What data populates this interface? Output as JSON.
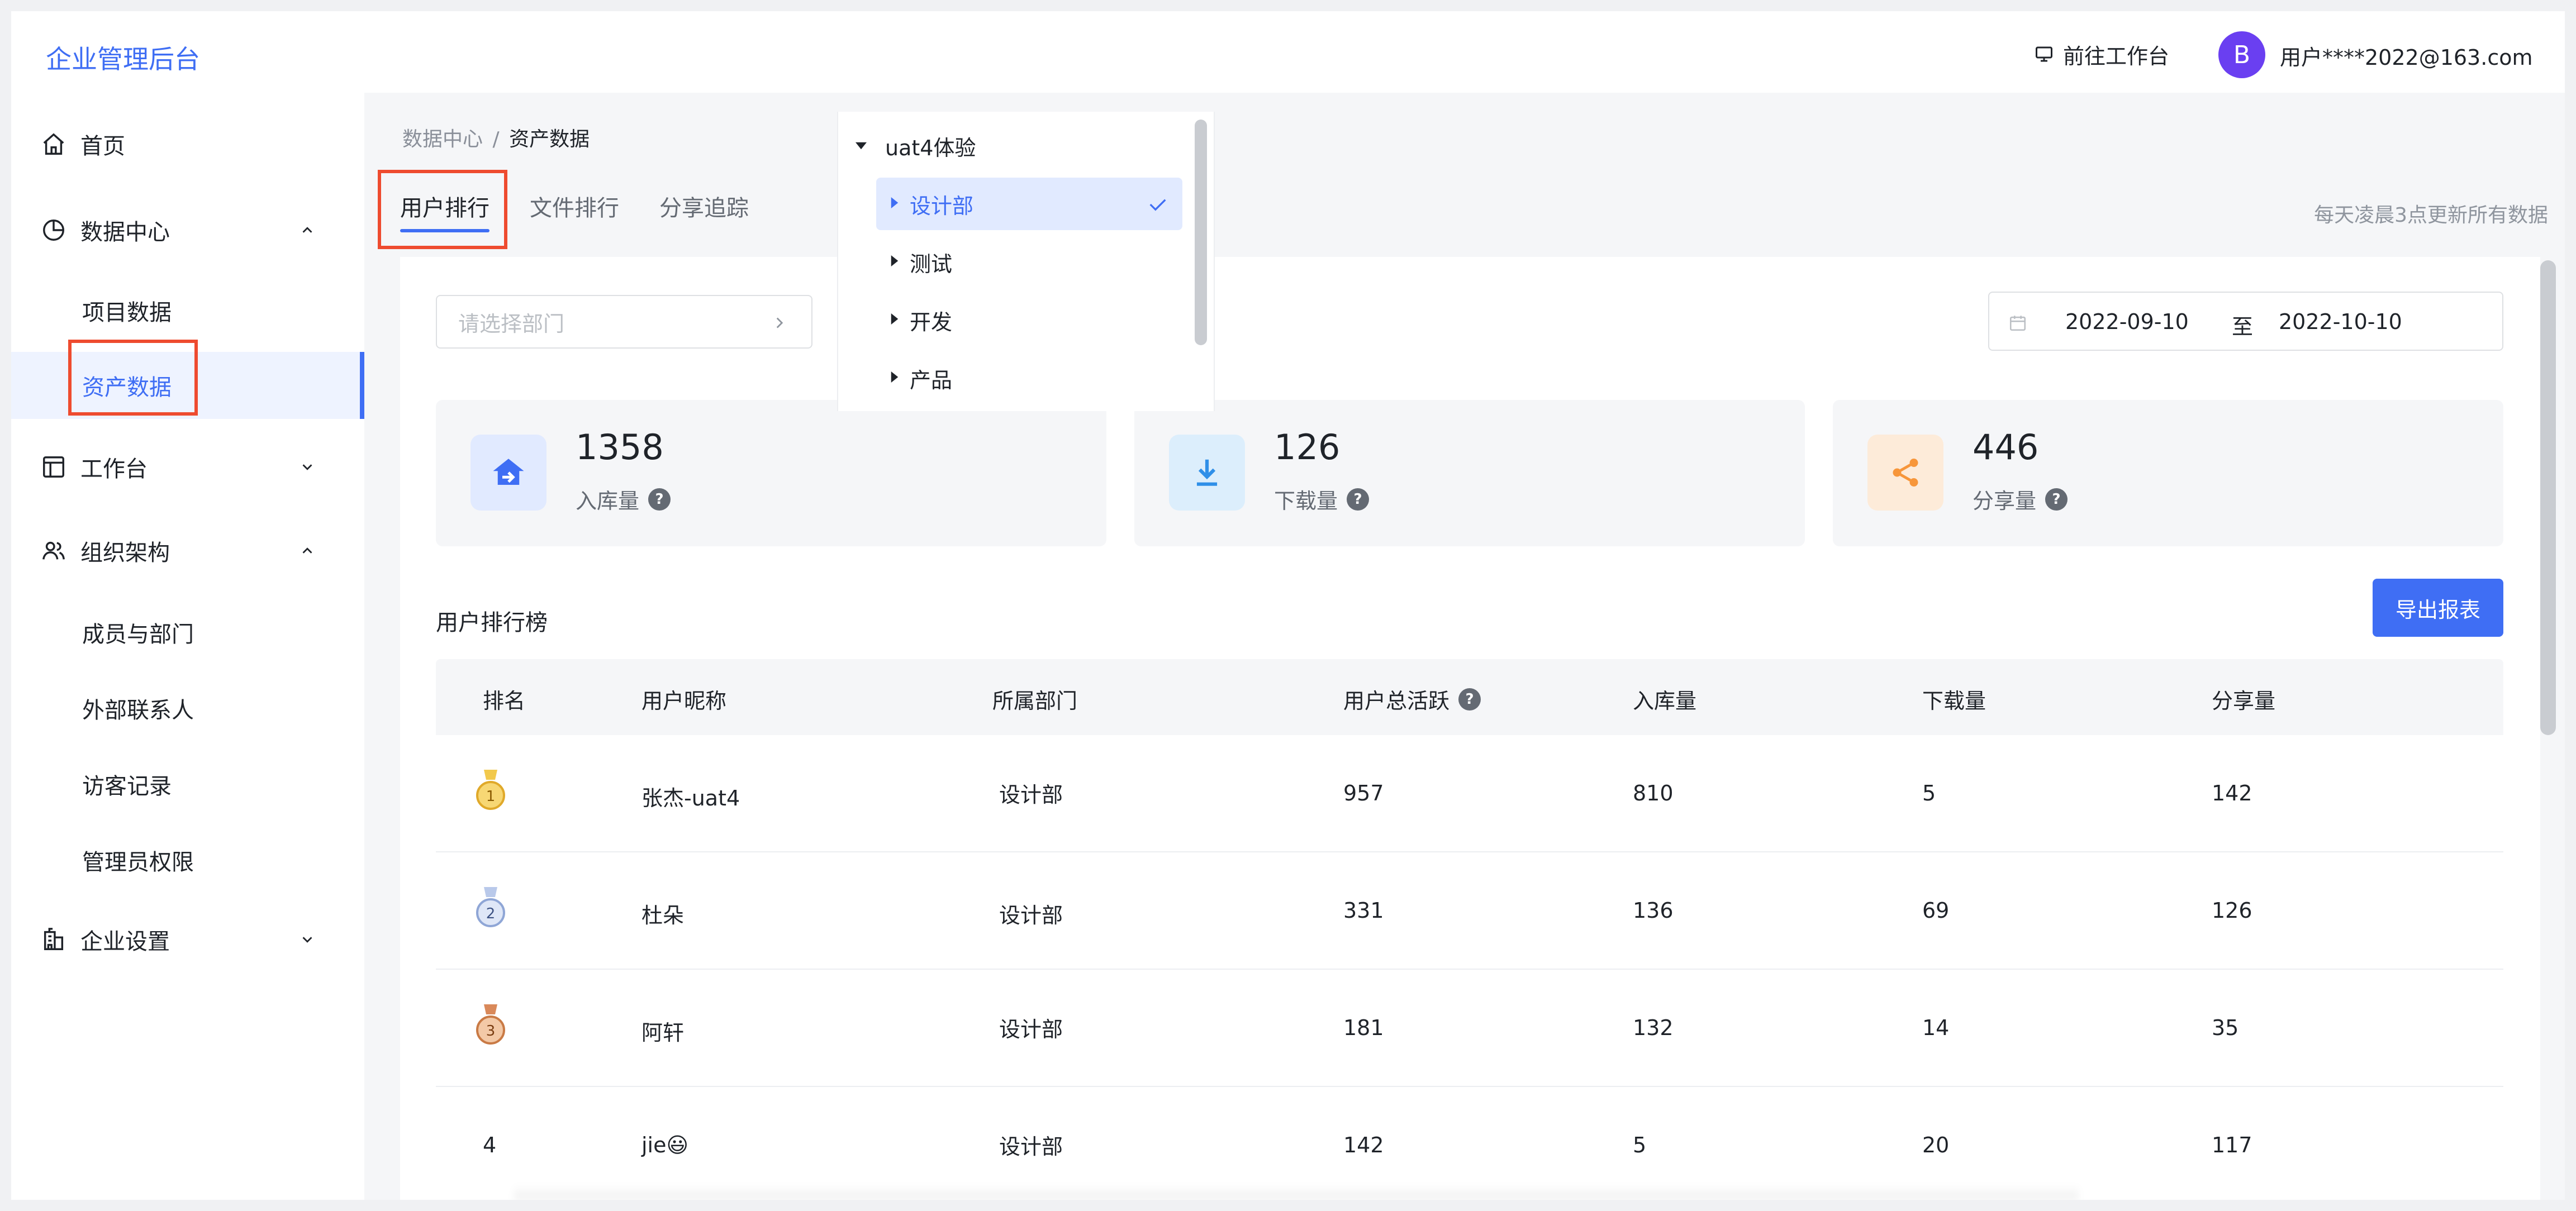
{
  "app": {
    "title": "企业管理后台"
  },
  "header": {
    "workbench_link": "前往工作台",
    "avatar_initial": "B",
    "user_email": "用户****2022@163.com"
  },
  "sidebar": {
    "items": [
      {
        "label": "首页",
        "icon": "home-icon"
      },
      {
        "label": "数据中心",
        "icon": "pie-chart-icon",
        "expanded": true,
        "children": [
          {
            "label": "项目数据"
          },
          {
            "label": "资产数据",
            "active": true
          }
        ]
      },
      {
        "label": "工作台",
        "icon": "layout-icon",
        "expanded": false
      },
      {
        "label": "组织架构",
        "icon": "users-icon",
        "expanded": true,
        "children": [
          {
            "label": "成员与部门"
          },
          {
            "label": "外部联系人"
          },
          {
            "label": "访客记录"
          },
          {
            "label": "管理员权限"
          }
        ]
      },
      {
        "label": "企业设置",
        "icon": "building-icon",
        "expanded": false
      }
    ]
  },
  "breadcrumb": {
    "parent": "数据中心",
    "separator": "/",
    "current": "资产数据"
  },
  "tabs": [
    {
      "label": "用户排行",
      "active": true
    },
    {
      "label": "文件排行"
    },
    {
      "label": "分享追踪"
    }
  ],
  "update_note": "每天凌晨3点更新所有数据",
  "filters": {
    "dept_placeholder": "请选择部门",
    "date_start": "2022-09-10",
    "date_separator": "至",
    "date_end": "2022-10-10"
  },
  "dept_tree": {
    "root": "uat4体验",
    "nodes": [
      {
        "label": "设计部",
        "selected": true
      },
      {
        "label": "测试"
      },
      {
        "label": "开发"
      },
      {
        "label": "产品"
      }
    ]
  },
  "stats": [
    {
      "value": "1358",
      "label": "入库量",
      "icon": "upload-home-icon",
      "color": "#3f6ef4"
    },
    {
      "value": "126",
      "label": "下载量",
      "icon": "download-icon",
      "color": "#2f8fe8"
    },
    {
      "value": "446",
      "label": "分享量",
      "icon": "share-icon",
      "color": "#f7963a"
    }
  ],
  "ranking": {
    "title": "用户排行榜",
    "export_label": "导出报表",
    "columns": [
      "排名",
      "用户昵称",
      "所属部门",
      "用户总活跃",
      "入库量",
      "下载量",
      "分享量"
    ],
    "rows": [
      {
        "rank": "1",
        "name": "张杰-uat4",
        "dept": "设计部",
        "active": "957",
        "stored": "810",
        "downloads": "5",
        "shares": "142"
      },
      {
        "rank": "2",
        "name": "杜朵",
        "dept": "设计部",
        "active": "331",
        "stored": "136",
        "downloads": "69",
        "shares": "126"
      },
      {
        "rank": "3",
        "name": "阿轩",
        "dept": "设计部",
        "active": "181",
        "stored": "132",
        "downloads": "14",
        "shares": "35"
      },
      {
        "rank": "4",
        "name": "jie😃",
        "dept": "设计部",
        "active": "142",
        "stored": "5",
        "downloads": "20",
        "shares": "117"
      }
    ]
  },
  "help_glyph": "?"
}
